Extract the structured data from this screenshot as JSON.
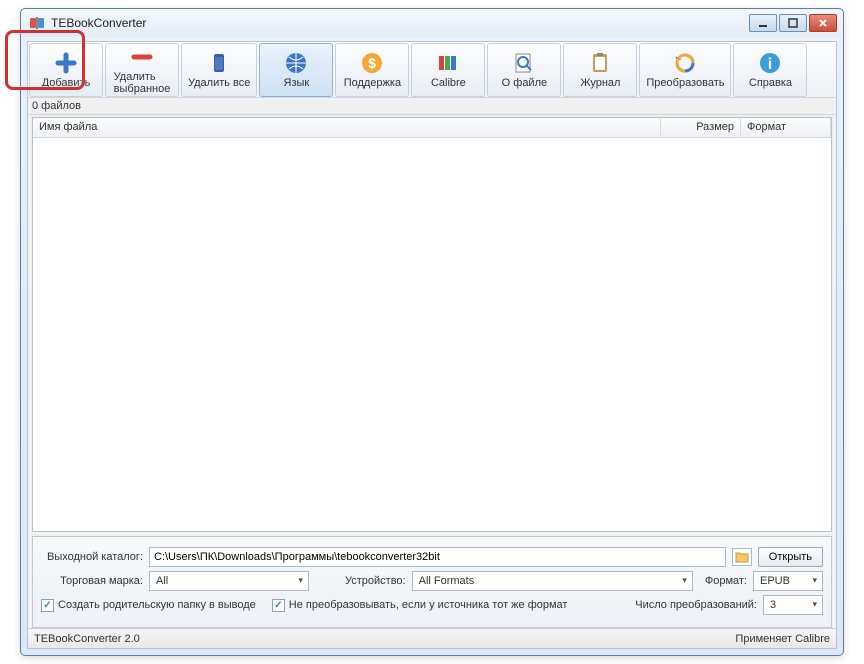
{
  "title": "TEBookConverter",
  "toolbar": [
    {
      "id": "add",
      "label": "Добавить",
      "icon": "plus"
    },
    {
      "id": "delete-selected",
      "label": "Удалить выбранное",
      "icon": "minus"
    },
    {
      "id": "delete-all",
      "label": "Удалить все",
      "icon": "trash"
    },
    {
      "id": "language",
      "label": "Язык",
      "icon": "globe"
    },
    {
      "id": "support",
      "label": "Поддержка",
      "icon": "dollar"
    },
    {
      "id": "calibre",
      "label": "Calibre",
      "icon": "books"
    },
    {
      "id": "about",
      "label": "О файле",
      "icon": "magnifier"
    },
    {
      "id": "journal",
      "label": "Журнал",
      "icon": "clipboard"
    },
    {
      "id": "convert",
      "label": "Преобразовать",
      "icon": "refresh"
    },
    {
      "id": "help",
      "label": "Справка",
      "icon": "info"
    }
  ],
  "file_count": "0 файлов",
  "columns": {
    "name": "Имя файла",
    "size": "Размер",
    "format": "Формат"
  },
  "bottom": {
    "output_label": "Выходной каталог:",
    "output_path": "C:\\Users\\ПК\\Downloads\\Программы\\tebookconverter32bit",
    "open_btn": "Открыть",
    "brand_label": "Торговая марка:",
    "brand_value": "All",
    "device_label": "Устройство:",
    "device_value": "All Formats",
    "format_label": "Формат:",
    "format_value": "EPUB",
    "cb1": "Создать родительскую папку в выводе",
    "cb2": "Не преобразовывать, если у источника тот же формат",
    "threads_label": "Число преобразований:",
    "threads_value": "3"
  },
  "status": {
    "left": "TEBookConverter 2.0",
    "right": "Применяет Calibre"
  }
}
